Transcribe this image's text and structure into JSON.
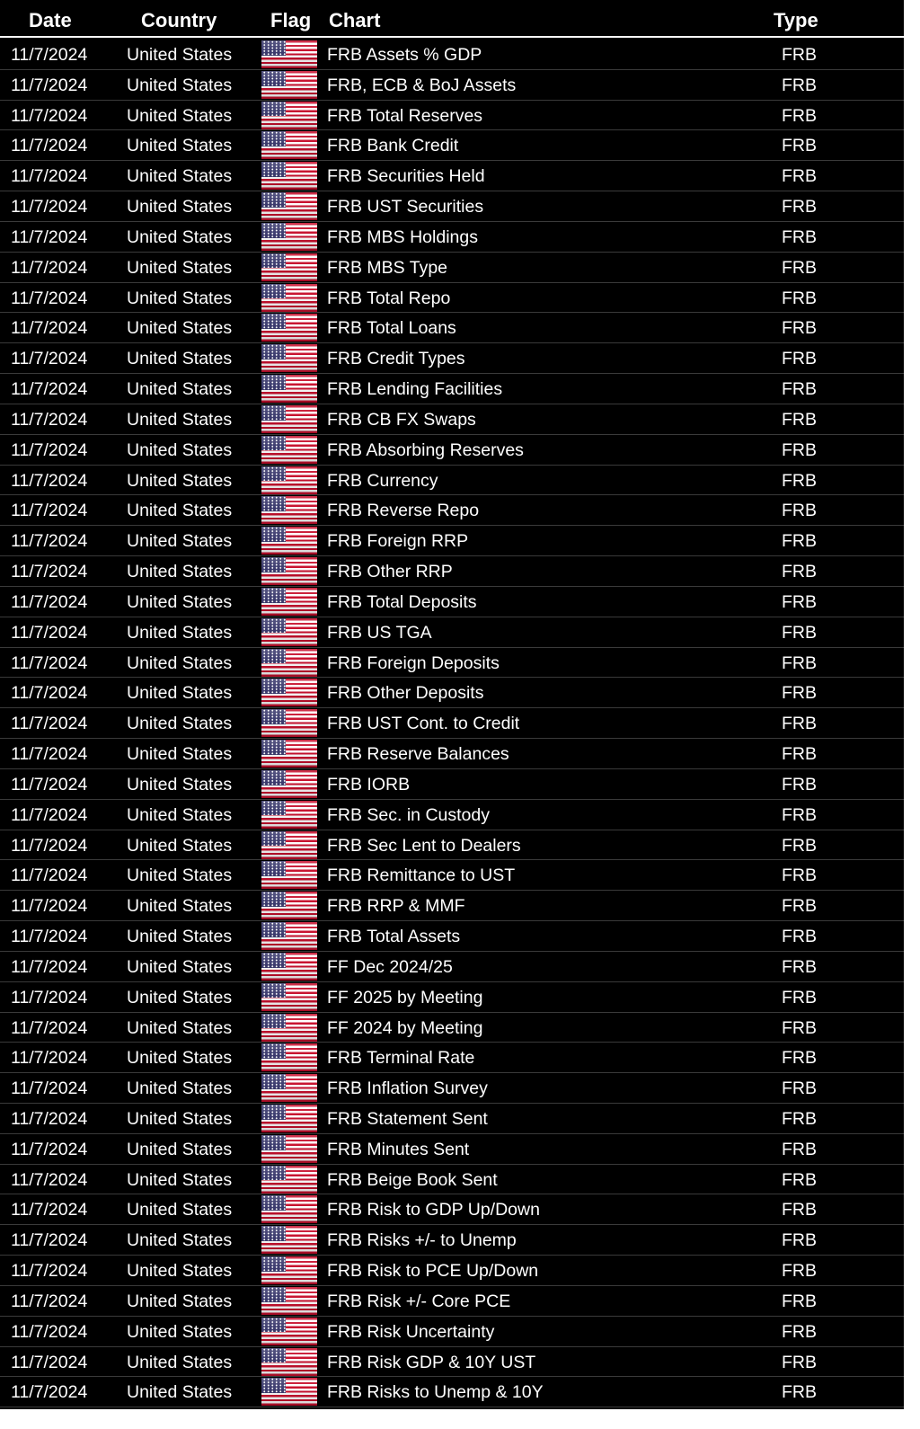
{
  "header": {
    "date": "Date",
    "country": "Country",
    "flag": "Flag",
    "chart": "Chart",
    "type": "Type"
  },
  "flag_icon": "us-flag-icon",
  "rows": [
    {
      "date": "11/7/2024",
      "country": "United States",
      "chart": "FRB Assets % GDP",
      "type": "FRB"
    },
    {
      "date": "11/7/2024",
      "country": "United States",
      "chart": "FRB, ECB & BoJ Assets",
      "type": "FRB"
    },
    {
      "date": "11/7/2024",
      "country": "United States",
      "chart": "FRB Total Reserves",
      "type": "FRB"
    },
    {
      "date": "11/7/2024",
      "country": "United States",
      "chart": "FRB Bank Credit",
      "type": "FRB"
    },
    {
      "date": "11/7/2024",
      "country": "United States",
      "chart": "FRB Securities Held",
      "type": "FRB"
    },
    {
      "date": "11/7/2024",
      "country": "United States",
      "chart": "FRB UST Securities",
      "type": "FRB"
    },
    {
      "date": "11/7/2024",
      "country": "United States",
      "chart": "FRB MBS Holdings",
      "type": "FRB"
    },
    {
      "date": "11/7/2024",
      "country": "United States",
      "chart": "FRB MBS Type",
      "type": "FRB"
    },
    {
      "date": "11/7/2024",
      "country": "United States",
      "chart": "FRB Total Repo",
      "type": "FRB"
    },
    {
      "date": "11/7/2024",
      "country": "United States",
      "chart": "FRB Total Loans",
      "type": "FRB"
    },
    {
      "date": "11/7/2024",
      "country": "United States",
      "chart": "FRB Credit Types",
      "type": "FRB"
    },
    {
      "date": "11/7/2024",
      "country": "United States",
      "chart": "FRB Lending Facilities",
      "type": "FRB"
    },
    {
      "date": "11/7/2024",
      "country": "United States",
      "chart": "FRB CB FX Swaps",
      "type": "FRB"
    },
    {
      "date": "11/7/2024",
      "country": "United States",
      "chart": "FRB Absorbing Reserves",
      "type": "FRB"
    },
    {
      "date": "11/7/2024",
      "country": "United States",
      "chart": "FRB Currency",
      "type": "FRB"
    },
    {
      "date": "11/7/2024",
      "country": "United States",
      "chart": "FRB Reverse Repo",
      "type": "FRB"
    },
    {
      "date": "11/7/2024",
      "country": "United States",
      "chart": "FRB Foreign RRP",
      "type": "FRB"
    },
    {
      "date": "11/7/2024",
      "country": "United States",
      "chart": "FRB Other RRP",
      "type": "FRB"
    },
    {
      "date": "11/7/2024",
      "country": "United States",
      "chart": "FRB Total Deposits",
      "type": "FRB"
    },
    {
      "date": "11/7/2024",
      "country": "United States",
      "chart": "FRB US TGA",
      "type": "FRB"
    },
    {
      "date": "11/7/2024",
      "country": "United States",
      "chart": "FRB Foreign Deposits",
      "type": "FRB"
    },
    {
      "date": "11/7/2024",
      "country": "United States",
      "chart": "FRB Other Deposits",
      "type": "FRB"
    },
    {
      "date": "11/7/2024",
      "country": "United States",
      "chart": "FRB UST Cont. to Credit",
      "type": "FRB"
    },
    {
      "date": "11/7/2024",
      "country": "United States",
      "chart": "FRB Reserve Balances",
      "type": "FRB"
    },
    {
      "date": "11/7/2024",
      "country": "United States",
      "chart": "FRB IORB",
      "type": "FRB"
    },
    {
      "date": "11/7/2024",
      "country": "United States",
      "chart": "FRB Sec. in Custody",
      "type": "FRB"
    },
    {
      "date": "11/7/2024",
      "country": "United States",
      "chart": "FRB Sec Lent to Dealers",
      "type": "FRB"
    },
    {
      "date": "11/7/2024",
      "country": "United States",
      "chart": "FRB Remittance to UST",
      "type": "FRB"
    },
    {
      "date": "11/7/2024",
      "country": "United States",
      "chart": "FRB RRP & MMF",
      "type": "FRB"
    },
    {
      "date": "11/7/2024",
      "country": "United States",
      "chart": "FRB Total Assets",
      "type": "FRB"
    },
    {
      "date": "11/7/2024",
      "country": "United States",
      "chart": "FF Dec 2024/25",
      "type": "FRB"
    },
    {
      "date": "11/7/2024",
      "country": "United States",
      "chart": "FF 2025 by Meeting",
      "type": "FRB"
    },
    {
      "date": "11/7/2024",
      "country": "United States",
      "chart": "FF 2024 by Meeting",
      "type": "FRB"
    },
    {
      "date": "11/7/2024",
      "country": "United States",
      "chart": "FRB Terminal Rate",
      "type": "FRB"
    },
    {
      "date": "11/7/2024",
      "country": "United States",
      "chart": "FRB Inflation Survey",
      "type": "FRB"
    },
    {
      "date": "11/7/2024",
      "country": "United States",
      "chart": "FRB Statement Sent",
      "type": "FRB"
    },
    {
      "date": "11/7/2024",
      "country": "United States",
      "chart": "FRB Minutes Sent",
      "type": "FRB"
    },
    {
      "date": "11/7/2024",
      "country": "United States",
      "chart": "FRB Beige Book Sent",
      "type": "FRB"
    },
    {
      "date": "11/7/2024",
      "country": "United States",
      "chart": "FRB Risk to GDP Up/Down",
      "type": "FRB"
    },
    {
      "date": "11/7/2024",
      "country": "United States",
      "chart": "FRB Risks +/- to Unemp",
      "type": "FRB"
    },
    {
      "date": "11/7/2024",
      "country": "United States",
      "chart": "FRB Risk to PCE Up/Down",
      "type": "FRB"
    },
    {
      "date": "11/7/2024",
      "country": "United States",
      "chart": "FRB Risk +/- Core PCE",
      "type": "FRB"
    },
    {
      "date": "11/7/2024",
      "country": "United States",
      "chart": "FRB Risk Uncertainty",
      "type": "FRB"
    },
    {
      "date": "11/7/2024",
      "country": "United States",
      "chart": "FRB Risk GDP & 10Y UST",
      "type": "FRB"
    },
    {
      "date": "11/7/2024",
      "country": "United States",
      "chart": "FRB Risks to Unemp & 10Y",
      "type": "FRB"
    }
  ]
}
